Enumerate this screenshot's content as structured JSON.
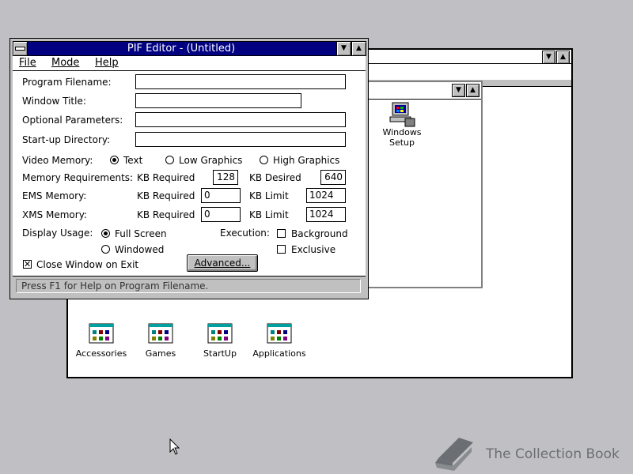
{
  "pif_editor": {
    "title": "PIF Editor - (Untitled)",
    "menu": [
      "File",
      "Mode",
      "Help"
    ],
    "fields": {
      "program_filename": {
        "label": "Program Filename:",
        "value": ""
      },
      "window_title": {
        "label": "Window Title:",
        "value": ""
      },
      "optional_parameters": {
        "label": "Optional Parameters:",
        "value": ""
      },
      "startup_directory": {
        "label": "Start-up Directory:",
        "value": ""
      }
    },
    "video_memory": {
      "label": "Video Memory:",
      "options": [
        "Text",
        "Low Graphics",
        "High Graphics"
      ],
      "selected": "Text"
    },
    "memory_requirements": {
      "label": "Memory Requirements:",
      "kb_required_label": "KB Required",
      "kb_required": "128",
      "kb_desired_label": "KB Desired",
      "kb_desired": "640"
    },
    "ems_memory": {
      "label": "EMS Memory:",
      "kb_required_label": "KB Required",
      "kb_required": "0",
      "kb_limit_label": "KB Limit",
      "kb_limit": "1024"
    },
    "xms_memory": {
      "label": "XMS Memory:",
      "kb_required_label": "KB Required",
      "kb_required": "0",
      "kb_limit_label": "KB Limit",
      "kb_limit": "1024"
    },
    "display_usage": {
      "label": "Display Usage:",
      "options": [
        "Full Screen",
        "Windowed"
      ],
      "selected": "Full Screen"
    },
    "execution": {
      "label": "Execution:",
      "background": "Background",
      "exclusive": "Exclusive"
    },
    "close_window_on_exit": {
      "label": "Close Window on Exit",
      "checked": true
    },
    "advanced_button": "Advanced...",
    "status": "Press F1 for Help on Program Filename."
  },
  "background_group": {
    "icons": [
      "Accessories",
      "Games",
      "StartUp",
      "Applications"
    ]
  },
  "main_group": {
    "icon_label_1": "Windows",
    "icon_label_2": "Setup"
  },
  "watermark": "The Collection Book",
  "colors": {
    "titlebar_active": "#000080",
    "desktop": "#c0c0c4"
  }
}
